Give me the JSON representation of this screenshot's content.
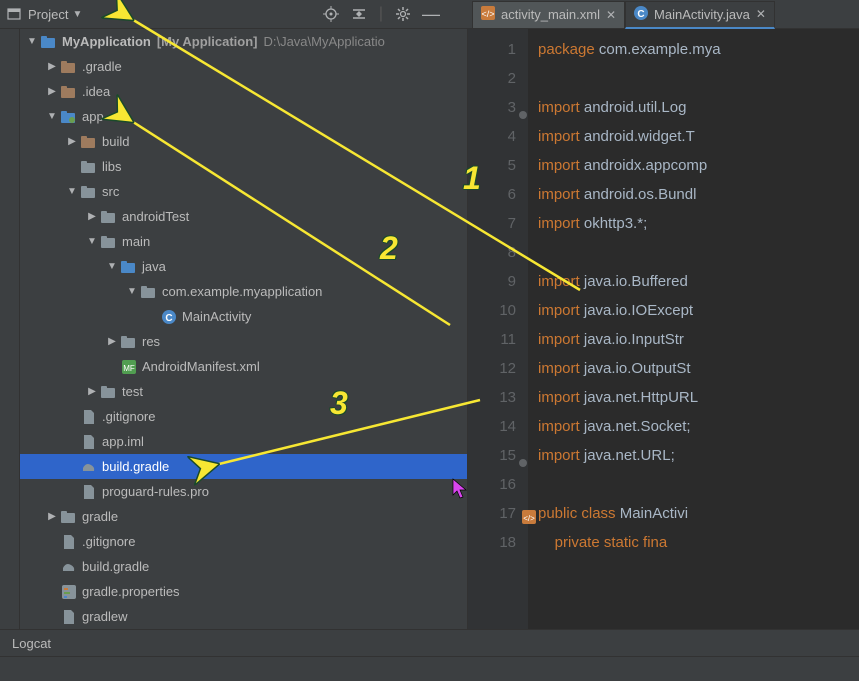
{
  "toolbar": {
    "project_label": "Project"
  },
  "tabs": [
    {
      "name": "activity_main.xml",
      "active": false,
      "icon_color": "#c87b3c"
    },
    {
      "name": "MainActivity.java",
      "active": true,
      "icon_color": "#4a88c7"
    }
  ],
  "tree": {
    "root": {
      "name": "MyApplication",
      "bracket": "[My Application]",
      "path": "D:\\Java\\MyApplicatio"
    },
    "items": [
      {
        "label": ".gradle",
        "indent": 1,
        "arrow": "right",
        "iconClass": "folder-icon orange"
      },
      {
        "label": ".idea",
        "indent": 1,
        "arrow": "right",
        "iconClass": "folder-icon orange"
      },
      {
        "label": "app",
        "indent": 1,
        "arrow": "down",
        "iconClass": "module-icon"
      },
      {
        "label": "build",
        "indent": 2,
        "arrow": "right",
        "iconClass": "folder-icon orange"
      },
      {
        "label": "libs",
        "indent": 2,
        "arrow": "",
        "iconClass": "folder-icon"
      },
      {
        "label": "src",
        "indent": 2,
        "arrow": "down",
        "iconClass": "folder-icon"
      },
      {
        "label": "androidTest",
        "indent": 3,
        "arrow": "right",
        "iconClass": "folder-icon"
      },
      {
        "label": "main",
        "indent": 3,
        "arrow": "down",
        "iconClass": "folder-icon"
      },
      {
        "label": "java",
        "indent": 4,
        "arrow": "down",
        "iconClass": "folder-icon blue"
      },
      {
        "label": "com.example.myapplication",
        "indent": 5,
        "arrow": "down",
        "iconClass": "folder-icon"
      },
      {
        "label": "MainActivity",
        "indent": 6,
        "arrow": "",
        "iconClass": "java-class"
      },
      {
        "label": "res",
        "indent": 4,
        "arrow": "right",
        "iconClass": "folder-icon"
      },
      {
        "label": "AndroidManifest.xml",
        "indent": 4,
        "arrow": "",
        "iconClass": "manifest"
      },
      {
        "label": "test",
        "indent": 3,
        "arrow": "right",
        "iconClass": "folder-icon"
      },
      {
        "label": ".gitignore",
        "indent": 2,
        "arrow": "",
        "iconClass": "file"
      },
      {
        "label": "app.iml",
        "indent": 2,
        "arrow": "",
        "iconClass": "file"
      },
      {
        "label": "build.gradle",
        "indent": 2,
        "arrow": "",
        "iconClass": "gradle",
        "selected": true
      },
      {
        "label": "proguard-rules.pro",
        "indent": 2,
        "arrow": "",
        "iconClass": "file"
      },
      {
        "label": "gradle",
        "indent": 1,
        "arrow": "right",
        "iconClass": "folder-icon"
      },
      {
        "label": ".gitignore",
        "indent": 1,
        "arrow": "",
        "iconClass": "file"
      },
      {
        "label": "build.gradle",
        "indent": 1,
        "arrow": "",
        "iconClass": "gradle"
      },
      {
        "label": "gradle.properties",
        "indent": 1,
        "arrow": "",
        "iconClass": "props"
      },
      {
        "label": "gradlew",
        "indent": 1,
        "arrow": "",
        "iconClass": "file"
      }
    ]
  },
  "editor": {
    "lines": [
      {
        "n": 1,
        "kw": "package",
        "rest": " com.example.mya"
      },
      {
        "n": 2,
        "kw": "",
        "rest": ""
      },
      {
        "n": 3,
        "kw": "import",
        "rest": " android.util.Log"
      },
      {
        "n": 4,
        "kw": "import",
        "rest": " android.widget.T"
      },
      {
        "n": 5,
        "kw": "import",
        "rest": " androidx.appcomp"
      },
      {
        "n": 6,
        "kw": "import",
        "rest": " android.os.Bundl"
      },
      {
        "n": 7,
        "kw": "import",
        "rest": " okhttp3.*;"
      },
      {
        "n": 8,
        "kw": "",
        "rest": ""
      },
      {
        "n": 9,
        "kw": "import",
        "rest": " java.io.Buffered"
      },
      {
        "n": 10,
        "kw": "import",
        "rest": " java.io.IOExcept"
      },
      {
        "n": 11,
        "kw": "import",
        "rest": " java.io.InputStr"
      },
      {
        "n": 12,
        "kw": "import",
        "rest": " java.io.OutputSt"
      },
      {
        "n": 13,
        "kw": "import",
        "rest": " java.net.HttpURL"
      },
      {
        "n": 14,
        "kw": "import",
        "rest": " java.net.Socket;"
      },
      {
        "n": 15,
        "kw": "import",
        "rest": " java.net.URL;"
      },
      {
        "n": 16,
        "kw": "",
        "rest": ""
      },
      {
        "n": 17,
        "kw": "public class",
        "rest": " MainActivi",
        "indent": ""
      },
      {
        "n": 18,
        "kw": "private static fina",
        "rest": "",
        "indent": "    "
      }
    ]
  },
  "bottom": {
    "logcat": "Logcat"
  },
  "annotations": {
    "a1": "1",
    "a2": "2",
    "a3": "3"
  }
}
